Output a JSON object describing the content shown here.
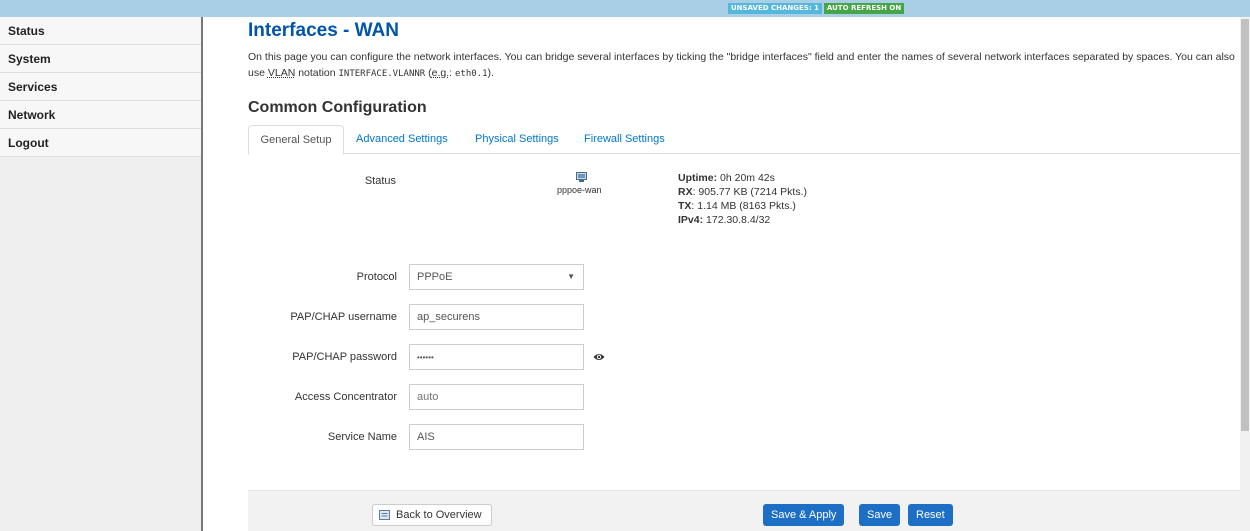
{
  "topbar": {
    "unsaved_changes": "UNSAVED CHANGES: 1",
    "auto_refresh": "AUTO REFRESH ON",
    "colors": {
      "bar": "#a9cfe6",
      "changes_badge": "#55b7dc",
      "refresh_badge": "#46a546"
    }
  },
  "sidebar": {
    "items": [
      {
        "label": "Status"
      },
      {
        "label": "System"
      },
      {
        "label": "Services"
      },
      {
        "label": "Network"
      },
      {
        "label": "Logout"
      }
    ]
  },
  "page": {
    "title": "Interfaces - WAN",
    "desc_part1": "On this page you can configure the network interfaces. You can bridge several interfaces by ticking the \"bridge interfaces\" field and enter the names of several network interfaces separated by spaces. You can also use ",
    "desc_vlan": "VLAN",
    "desc_part2": " notation ",
    "desc_code1": "INTERFACE.VLANNR",
    "desc_part3": " (",
    "desc_eg": "e.g.",
    "desc_part4": ": ",
    "desc_code2": "eth0.1",
    "desc_part5": ").",
    "section_title": "Common Configuration",
    "title_color": "#0055aa"
  },
  "tabs": [
    {
      "label": "General Setup",
      "active": true
    },
    {
      "label": "Advanced Settings",
      "active": false
    },
    {
      "label": "Physical Settings",
      "active": false
    },
    {
      "label": "Firewall Settings",
      "active": false
    }
  ],
  "status": {
    "label": "Status",
    "icon": "network-interface-icon",
    "ifname": "pppoe-wan",
    "uptime_label": "Uptime:",
    "uptime_value": " 0h 20m 42s",
    "rx_label": "RX",
    "rx_value": ": 905.77 KB (7214 Pkts.)",
    "tx_label": "TX",
    "tx_value": ": 1.14 MB (8163 Pkts.)",
    "ipv4_label": "IPv4:",
    "ipv4_value": " 172.30.8.4/32"
  },
  "form": {
    "protocol_label": "Protocol",
    "protocol_value": "PPPoE",
    "username_label": "PAP/CHAP username",
    "username_value": "ap_securens",
    "password_label": "PAP/CHAP password",
    "password_value": "••••••",
    "password_reveal_icon": "eye-icon",
    "ac_label": "Access Concentrator",
    "ac_placeholder": "auto",
    "service_label": "Service Name",
    "service_value": "AIS"
  },
  "footer": {
    "back_label": "Back to Overview",
    "back_icon": "back-icon",
    "save_apply_label": "Save & Apply",
    "save_label": "Save",
    "reset_label": "Reset",
    "button_color": "#1d6fc6"
  }
}
